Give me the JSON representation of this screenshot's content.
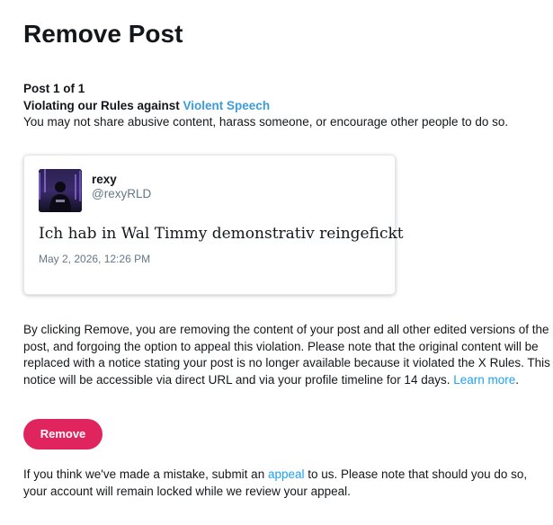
{
  "page": {
    "title": "Remove Post"
  },
  "violation": {
    "counter": "Post 1 of 1",
    "prefix": "Violating our Rules against ",
    "rule_link": "Violent Speech",
    "description": "You may not share abusive content, harass someone, or encourage other people to do so."
  },
  "post": {
    "display_name": "rexy",
    "handle": "@rexyRLD",
    "text": "Ich hab in Wal Timmy demonstrativ reingefickt",
    "timestamp": "May 2, 2026, 12:26 PM",
    "avatar_icon": "user-avatar-photo"
  },
  "notice": {
    "text": "By clicking Remove, you are removing the content of your post and all other edited versions of the post, and forgoing the option to appeal this violation. Please note that the original content will be replaced with a notice stating your post is no longer available because it violated the X Rules. This notice will be accessible via direct URL and via your profile timeline for 14 days. ",
    "learn_more": "Learn more",
    "suffix": "."
  },
  "actions": {
    "remove_label": "Remove"
  },
  "appeal": {
    "prefix": "If you think we've made a mistake, submit an ",
    "link": "appeal",
    "suffix": " to us. Please note that should you do so, your account will remain locked while we review your appeal."
  },
  "colors": {
    "text": "#14171a",
    "link": "#1da1f2",
    "muted": "#657786",
    "remove_button": "#e0245e",
    "card_border": "#e1e8ed"
  }
}
